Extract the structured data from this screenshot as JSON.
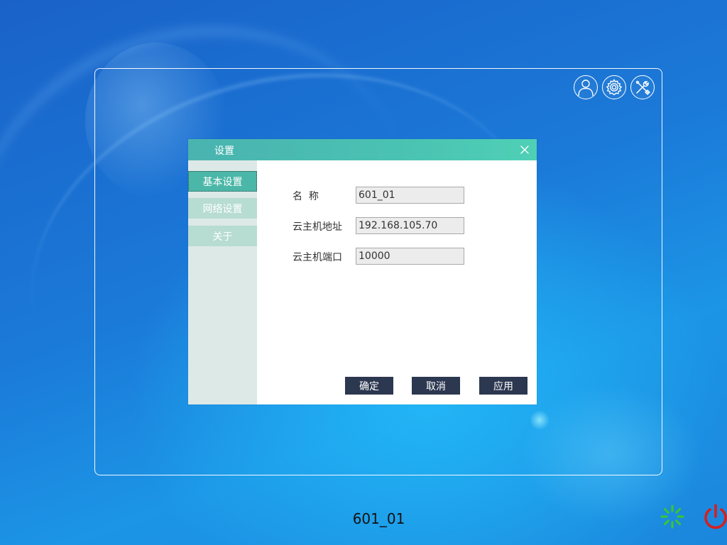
{
  "desktop": {
    "device_name": "601_01"
  },
  "toolbar": {
    "icons": [
      "user-icon",
      "gear-icon",
      "tools-icon"
    ]
  },
  "dialog": {
    "title": "设置",
    "close_icon": "close-icon",
    "tabs": [
      {
        "label": "基本设置",
        "active": true
      },
      {
        "label": "网络设置",
        "active": false
      },
      {
        "label": "关于",
        "active": false
      }
    ],
    "fields": [
      {
        "label": "名  称",
        "value": "601_01"
      },
      {
        "label": "云主机地址",
        "value": "192.168.105.70"
      },
      {
        "label": "云主机端口",
        "value": "10000"
      }
    ],
    "buttons": {
      "ok": "确定",
      "cancel": "取消",
      "apply": "应用"
    }
  },
  "status": {
    "loading_icon": "loading-spinner-icon",
    "power_icon": "power-icon"
  },
  "colors": {
    "titlebar": "#4ac2b2",
    "active_tab": "#4bb7a8",
    "inactive_tab": "#b7dcd2",
    "button": "#2c3750",
    "spinner": "#39c439",
    "power": "#d61f1f"
  }
}
